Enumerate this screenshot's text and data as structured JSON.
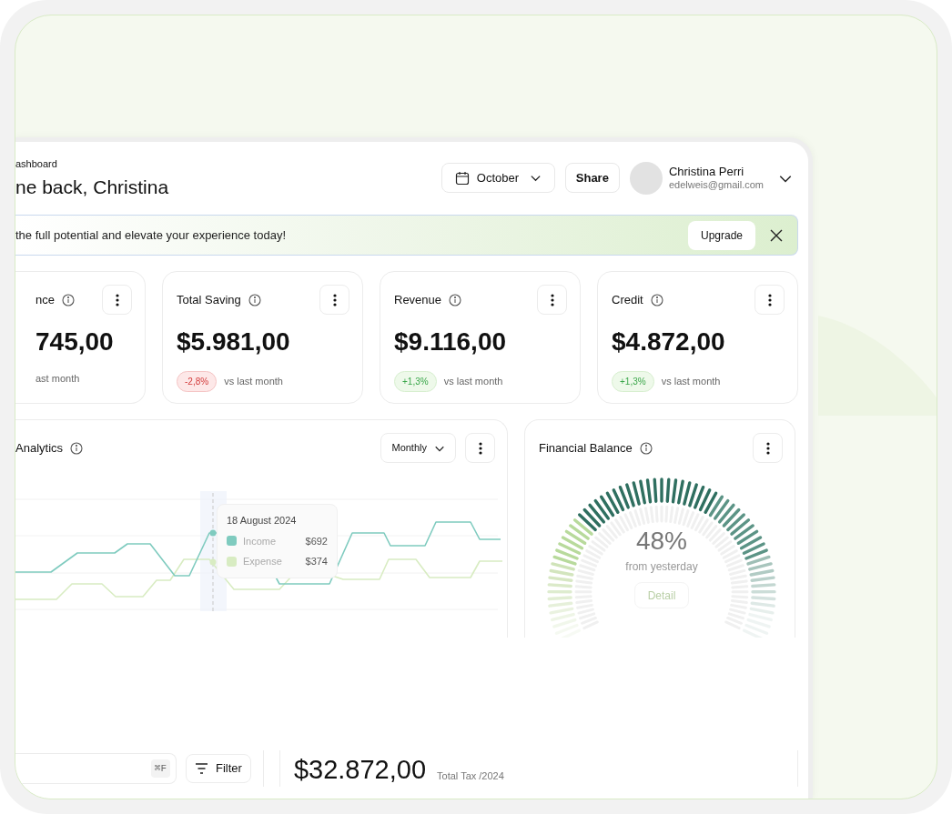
{
  "breadcrumb": "ashboard",
  "greeting": "ne back, Christina",
  "month_picker": {
    "value": "October"
  },
  "share_button": "Share",
  "user": {
    "name": "Christina Perri",
    "email": "edelweis@gmail.com"
  },
  "banner": {
    "message": "the full potential and elevate your experience today!",
    "button": "Upgrade"
  },
  "stat_cards": [
    {
      "title": "nce",
      "value": "745,00",
      "caption": "ast month"
    },
    {
      "title": "Total Saving",
      "value": "$5.981,00",
      "change": "-2,8%",
      "kind": "down",
      "caption": "vs last month"
    },
    {
      "title": "Revenue",
      "value": "$9.116,00",
      "change": "+1,3%",
      "kind": "up",
      "caption": "vs last month"
    },
    {
      "title": "Credit",
      "value": "$4.872,00",
      "change": "+1,3%",
      "kind": "up",
      "caption": "vs last month"
    }
  ],
  "analytics": {
    "title": "Analytics",
    "period": "Monthly",
    "tooltip": {
      "date": "18 August 2024",
      "items": [
        {
          "label": "Income",
          "value": "$692",
          "color": "#7fcbbf"
        },
        {
          "label": "Expense",
          "value": "$374",
          "color": "#d8ecc2"
        }
      ]
    }
  },
  "financial_balance": {
    "title": "Financial Balance",
    "percent": "48%",
    "caption": "from yesterday",
    "button": "Detail"
  },
  "search": {
    "shortcut": "⌘F"
  },
  "filter_button": "Filter",
  "tax": {
    "value": "$32.872,00",
    "label": "Total Tax /2024"
  }
}
